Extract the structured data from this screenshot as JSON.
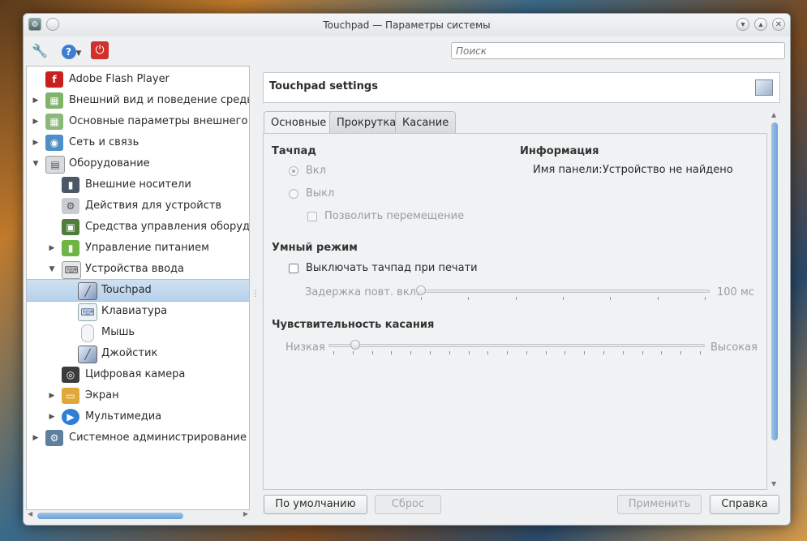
{
  "window": {
    "title": "Touchpad — Параметры системы"
  },
  "search": {
    "placeholder": "Поиск"
  },
  "sidebar": {
    "items": [
      {
        "label": "Adobe Flash Player"
      },
      {
        "label": "Внешний вид и поведение среды р"
      },
      {
        "label": "Основные параметры внешнего ви"
      },
      {
        "label": "Сеть и связь"
      },
      {
        "label": "Оборудование"
      },
      {
        "label": "Внешние носители"
      },
      {
        "label": "Действия для устройств"
      },
      {
        "label": "Средства управления оборудова"
      },
      {
        "label": "Управление питанием"
      },
      {
        "label": "Устройства ввода"
      },
      {
        "label": "Touchpad"
      },
      {
        "label": "Клавиатура"
      },
      {
        "label": "Мышь"
      },
      {
        "label": "Джойстик"
      },
      {
        "label": "Цифровая камера"
      },
      {
        "label": "Экран"
      },
      {
        "label": "Мультимедиа"
      },
      {
        "label": "Системное администрирование"
      }
    ]
  },
  "panel": {
    "title": "Touchpad settings"
  },
  "tabs": [
    {
      "label": "Основные"
    },
    {
      "label": "Прокрутка"
    },
    {
      "label": "Касание"
    }
  ],
  "touchpad": {
    "heading": "Тачпад",
    "on_label": "Вкл",
    "off_label": "Выкл",
    "allow_move_label": "Позволить перемещение",
    "selected": "Вкл"
  },
  "info": {
    "heading": "Информация",
    "panel_name_label": "Имя панели:",
    "panel_name_value": "Устройство не найдено"
  },
  "smart": {
    "heading": "Умный режим",
    "disable_on_typing_label": "Выключать тачпад при печати",
    "delay_label": "Задержка повт. вкл.:",
    "delay_value": "100 мс",
    "delay_fraction": 0.0
  },
  "sensitivity": {
    "heading": "Чувствительность касания",
    "low_label": "Низкая",
    "high_label": "Высокая",
    "fraction": 0.06
  },
  "buttons": {
    "defaults": "По умолчанию",
    "reset": "Сброс",
    "apply": "Применить",
    "help": "Справка"
  },
  "colors": {
    "accent": "#b6d1ec",
    "close_red": "#d0312d"
  }
}
